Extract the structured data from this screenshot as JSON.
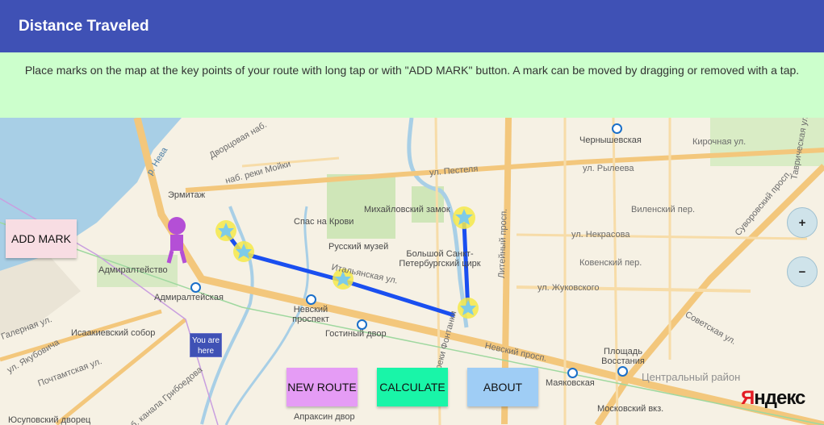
{
  "app": {
    "title": "Distance Traveled"
  },
  "hint": {
    "text": "Place marks on the map at the key points of your route with long tap or with \"ADD MARK\" button. A mark can be moved by dragging or removed with a tap."
  },
  "buttons": {
    "add_mark": "ADD MARK",
    "new_route": "NEW ROUTE",
    "calculate": "CALCULATE",
    "about": "ABOUT"
  },
  "zoom": {
    "in": "+",
    "out": "−"
  },
  "map": {
    "you_are_here": "You are here",
    "logo_first": "Я",
    "logo_rest": "ндекс",
    "labels": {
      "neva": "р. Нева",
      "dvortsovaya": "Дворцовая наб.",
      "hermitage": "Эрмитаж",
      "moika": "наб. реки Мойки",
      "spas": "Спас на Крови",
      "mikhailovsky": "Михайловский замок",
      "russian_museum": "Русский музей",
      "circus": "Большой Санкт-Петербургский цирк",
      "pestelya": "ул. Пестеля",
      "liteyny": "Литейный просп.",
      "chernyshevskaya": "Чернышевская",
      "kirochnaya": "Кирочная ул.",
      "ryleeva": "ул. Рылеева",
      "nekrasova": "ул. Некрасова",
      "vilenskiy": "Виленский пер.",
      "kovenskiy": "Ковенский пер.",
      "zhukovskogo": "ул. Жуковского",
      "admiralteystvo": "Адмиралтейство",
      "admiralteyskaya": "Адмиралтейская",
      "nevsky": "Невский проспект",
      "gostiny": "Гостиный двор",
      "isaakievsky": "Исаакиевский собор",
      "nevsky_prosp": "Невский просп.",
      "mayakovskaya": "Маяковская",
      "ploshchad": "Площадь Восстания",
      "central": "Центральный район",
      "moskovsky": "Московский вкз.",
      "apraksin": "Апраксин двор",
      "yusupov": "Юсуповский дворец",
      "italianskaya": "Итальянская ул.",
      "fontanki": "наб. реки Фонтанки",
      "suvorovsky": "Суворовский просп.",
      "tavricheskaya": "Таврическая ул.",
      "galernaya": "Галерная ул.",
      "pochtamtskaya": "Почтамтская ул.",
      "yakubovicha": "ул. Якубовича",
      "kanonerskaya": "наб. канала Грибоедова",
      "sovetskaya": "Советская ул."
    }
  },
  "colors": {
    "appbar": "#3f51b5",
    "hint_bg": "#ccffcc",
    "route": "#1a4ff0",
    "marker": "#f5e94a",
    "person": "#b44fd6"
  }
}
